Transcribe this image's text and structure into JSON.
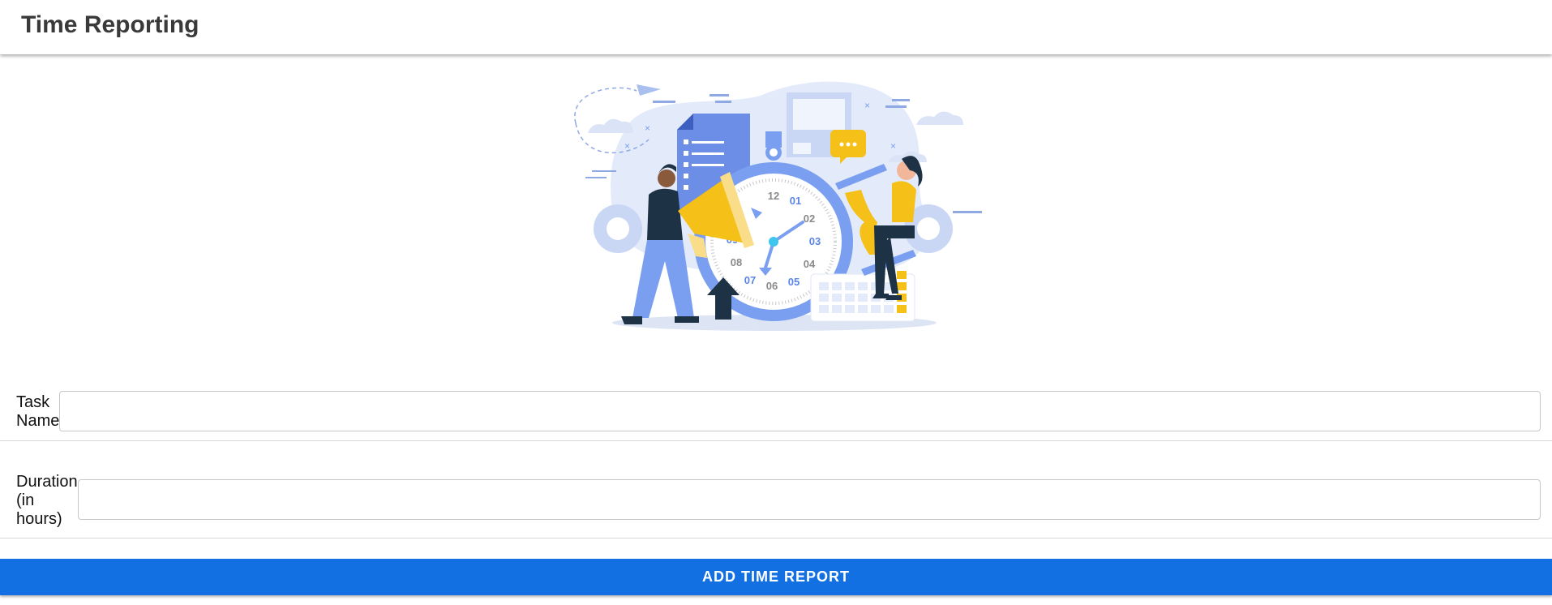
{
  "header": {
    "title": "Time Reporting"
  },
  "hero": {
    "illustration": "time-reporting-illustration",
    "clock_numbers": [
      "12",
      "01",
      "02",
      "03",
      "04",
      "05",
      "06",
      "07",
      "08",
      "09"
    ]
  },
  "form": {
    "task_label": "Task Name",
    "task_value": "",
    "duration_label": "Duration (in hours)",
    "duration_value": "",
    "submit_label": "ADD TIME REPORT"
  },
  "colors": {
    "primary": "#1270e3",
    "illustration_blue": "#7a9ff0",
    "illustration_yellow": "#f5c018",
    "illustration_dark": "#1e3246"
  }
}
